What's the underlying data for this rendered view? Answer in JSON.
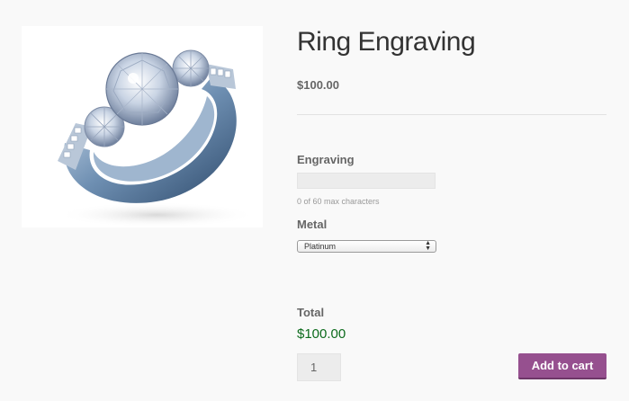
{
  "product": {
    "title": "Ring Engraving",
    "price": "$100.00",
    "image_icon": "diamond-ring-photo"
  },
  "engraving": {
    "label": "Engraving",
    "value": "",
    "hint": "0 of 60 max characters"
  },
  "metal": {
    "label": "Metal",
    "selected": "Platinum"
  },
  "total": {
    "label": "Total",
    "value": "$100.00"
  },
  "cart": {
    "quantity": "1",
    "button_label": "Add to cart"
  },
  "colors": {
    "accent": "#96508f",
    "total_green": "#0c6b1c"
  }
}
